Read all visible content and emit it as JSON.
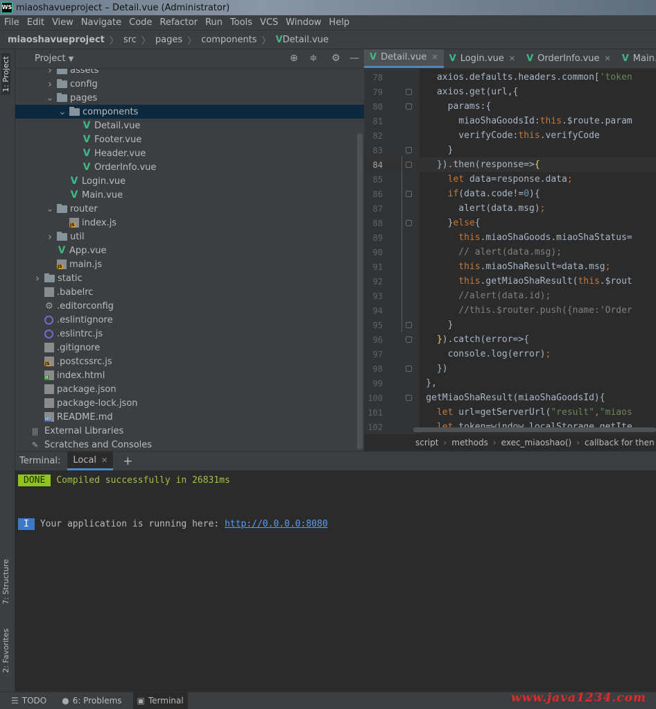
{
  "window": {
    "title": "miaoshavueproject – Detail.vue (Administrator)",
    "app_logo": "WS"
  },
  "menu": [
    "File",
    "Edit",
    "View",
    "Navigate",
    "Code",
    "Refactor",
    "Run",
    "Tools",
    "VCS",
    "Window",
    "Help"
  ],
  "breadcrumb": {
    "project": "miaoshavueproject",
    "items": [
      "src",
      "pages",
      "components",
      "Detail.vue"
    ]
  },
  "side_tabs": {
    "project": "1: Project",
    "structure": "7: Structure",
    "favorites": "2: Favorites"
  },
  "project_panel": {
    "title": "Project"
  },
  "tree": [
    {
      "label": "assets",
      "icon": "folder-icon",
      "depth": 2,
      "arrow": "right"
    },
    {
      "label": "config",
      "icon": "folder-icon",
      "depth": 2,
      "arrow": "right"
    },
    {
      "label": "pages",
      "icon": "folder-icon",
      "depth": 2,
      "arrow": "down"
    },
    {
      "label": "components",
      "icon": "folder-icon",
      "depth": 3,
      "arrow": "down",
      "selected": true
    },
    {
      "label": "Detail.vue",
      "icon": "vue-file-icon",
      "depth": 4
    },
    {
      "label": "Footer.vue",
      "icon": "vue-file-icon",
      "depth": 4
    },
    {
      "label": "Header.vue",
      "icon": "vue-file-icon",
      "depth": 4
    },
    {
      "label": "OrderInfo.vue",
      "icon": "vue-file-icon",
      "depth": 4
    },
    {
      "label": "Login.vue",
      "icon": "vue-file-icon",
      "depth": 3
    },
    {
      "label": "Main.vue",
      "icon": "vue-file-icon",
      "depth": 3
    },
    {
      "label": "router",
      "icon": "folder-icon",
      "depth": 2,
      "arrow": "down"
    },
    {
      "label": "index.js",
      "icon": "js-file-icon",
      "depth": 3
    },
    {
      "label": "util",
      "icon": "folder-icon",
      "depth": 2,
      "arrow": "right"
    },
    {
      "label": "App.vue",
      "icon": "vue-file-icon",
      "depth": 2
    },
    {
      "label": "main.js",
      "icon": "js-file-icon",
      "depth": 2
    },
    {
      "label": "static",
      "icon": "folder-icon",
      "depth": 1,
      "arrow": "right"
    },
    {
      "label": ".babelrc",
      "icon": "generic-file-icon",
      "depth": 1
    },
    {
      "label": ".editorconfig",
      "icon": "gear-icon",
      "depth": 1
    },
    {
      "label": ".eslintignore",
      "icon": "eslint-icon",
      "depth": 1
    },
    {
      "label": ".eslintrc.js",
      "icon": "eslint-icon",
      "depth": 1
    },
    {
      "label": ".gitignore",
      "icon": "generic-file-icon",
      "depth": 1
    },
    {
      "label": ".postcssrc.js",
      "icon": "js-file-icon",
      "depth": 1
    },
    {
      "label": "index.html",
      "icon": "html-file-icon",
      "depth": 1
    },
    {
      "label": "package.json",
      "icon": "generic-file-icon",
      "depth": 1
    },
    {
      "label": "package-lock.json",
      "icon": "generic-file-icon",
      "depth": 1
    },
    {
      "label": "README.md",
      "icon": "markdown-file-icon",
      "depth": 1
    },
    {
      "label": "External Libraries",
      "icon": "library-icon",
      "depth": 0
    },
    {
      "label": "Scratches and Consoles",
      "icon": "scratches-icon",
      "depth": 0
    }
  ],
  "editor_tabs": [
    {
      "label": "Detail.vue",
      "active": true
    },
    {
      "label": "Login.vue",
      "active": false
    },
    {
      "label": "OrderInfo.vue",
      "active": false
    },
    {
      "label": "Main.vue",
      "active": false
    }
  ],
  "code": [
    {
      "n": "78",
      "t": [
        [
          "      axios.defaults.headers.common[",
          "p"
        ],
        [
          "'token",
          "s"
        ]
      ]
    },
    {
      "n": "79",
      "t": [
        [
          "      axios.get(url,{",
          "p"
        ]
      ]
    },
    {
      "n": "80",
      "t": [
        [
          "        params:{",
          "p"
        ]
      ]
    },
    {
      "n": "81",
      "t": [
        [
          "          miaoShaGoodsId:",
          "p"
        ],
        [
          "this",
          ".kw"
        ],
        [
          ".$route.param",
          "p"
        ]
      ]
    },
    {
      "n": "82",
      "t": [
        [
          "          verifyCode:",
          "p"
        ],
        [
          "this",
          ".kw"
        ],
        [
          ".verifyCode",
          "p"
        ]
      ]
    },
    {
      "n": "83",
      "t": [
        [
          "        }",
          "p"
        ]
      ]
    },
    {
      "n": "84",
      "t": [
        [
          "      }).then(response=>",
          "p"
        ],
        [
          "{",
          "fn"
        ]
      ],
      "current": true
    },
    {
      "n": "85",
      "t": [
        [
          "        ",
          "p"
        ],
        [
          "let ",
          ".kw"
        ],
        [
          "data=response.data",
          ".p"
        ],
        [
          ";",
          ".kw"
        ]
      ]
    },
    {
      "n": "86",
      "t": [
        [
          "        ",
          "p"
        ],
        [
          "if",
          ".kw"
        ],
        [
          "(data.code!=",
          ".p"
        ],
        [
          "0",
          ".num"
        ],
        [
          "){",
          ".p"
        ]
      ]
    },
    {
      "n": "87",
      "t": [
        [
          "          alert(data.msg)",
          "p"
        ],
        [
          ";",
          ".kw"
        ]
      ]
    },
    {
      "n": "88",
      "t": [
        [
          "        }",
          "p"
        ],
        [
          "else",
          ".kw"
        ],
        [
          "{",
          ".p"
        ]
      ]
    },
    {
      "n": "89",
      "t": [
        [
          "          ",
          "p"
        ],
        [
          "this",
          ".kw"
        ],
        [
          ".miaoShaGoods.miaoShaStatus=",
          ".p"
        ]
      ]
    },
    {
      "n": "90",
      "t": [
        [
          "          // alert(data.msg);",
          "com"
        ]
      ]
    },
    {
      "n": "91",
      "t": [
        [
          "          ",
          "p"
        ],
        [
          "this",
          ".kw"
        ],
        [
          ".miaoShaResult=data.msg",
          ".p"
        ],
        [
          ";",
          ".kw"
        ]
      ]
    },
    {
      "n": "92",
      "t": [
        [
          "          ",
          "p"
        ],
        [
          "this",
          ".kw"
        ],
        [
          ".getMiaoShaResult(",
          ".p"
        ],
        [
          "this",
          ".kw"
        ],
        [
          ".$rout",
          ".p"
        ]
      ]
    },
    {
      "n": "93",
      "t": [
        [
          "          //alert(data.id);",
          "com"
        ]
      ]
    },
    {
      "n": "94",
      "t": [
        [
          "          //this.$router.push({name:'Order",
          "com"
        ]
      ]
    },
    {
      "n": "95",
      "t": [
        [
          "        }",
          "p"
        ]
      ]
    },
    {
      "n": "96",
      "t": [
        [
          "      ",
          "p"
        ],
        [
          "}",
          ".fn"
        ],
        [
          ").catch(error=>{",
          ".p"
        ]
      ]
    },
    {
      "n": "97",
      "t": [
        [
          "        console.log(error)",
          "p"
        ],
        [
          ";",
          ".kw"
        ]
      ]
    },
    {
      "n": "98",
      "t": [
        [
          "      })",
          "p"
        ]
      ]
    },
    {
      "n": "99",
      "t": [
        [
          "    },",
          "p"
        ]
      ]
    },
    {
      "n": "100",
      "t": [
        [
          "    getMiaoShaResult(miaoShaGoodsId){",
          "p"
        ]
      ]
    },
    {
      "n": "101",
      "t": [
        [
          "      ",
          "p"
        ],
        [
          "let ",
          ".kw"
        ],
        [
          "url=getServerUrl(",
          ".p"
        ],
        [
          "\"result\"",
          ".s"
        ],
        [
          ",",
          ".kw"
        ],
        [
          "\"miaos",
          ".s"
        ]
      ]
    },
    {
      "n": "102",
      "t": [
        [
          "      ",
          "p"
        ],
        [
          "let ",
          ".kw"
        ],
        [
          "token=window.localStorage.getIte",
          ".p"
        ]
      ]
    }
  ],
  "editor_crumb": [
    "script",
    "methods",
    "exec_miaoshao()",
    "callback for then"
  ],
  "terminal": {
    "label": "Terminal:",
    "tab": "Local",
    "done_badge": "DONE",
    "done_text": "Compiled successfully in 26831ms",
    "info_badge": "I",
    "info_text": "Your application is running here: ",
    "url": "http://0.0.0.0:8080"
  },
  "status": {
    "todo": "TODO",
    "problems": "6: Problems",
    "terminal": "Terminal"
  },
  "watermark": "www.java1234.com",
  "colors": {
    "accent": "#4a88c7",
    "vue": "#41b883",
    "done": "#8ec41b",
    "info": "#3c78c8",
    "watermark": "#e12a2a"
  }
}
